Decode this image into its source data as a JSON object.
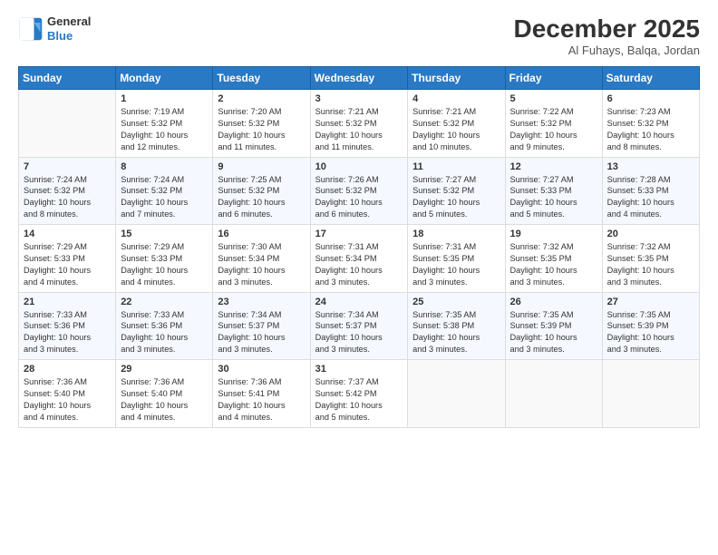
{
  "header": {
    "logo_line1": "General",
    "logo_line2": "Blue",
    "month_title": "December 2025",
    "location": "Al Fuhays, Balqa, Jordan"
  },
  "weekdays": [
    "Sunday",
    "Monday",
    "Tuesday",
    "Wednesday",
    "Thursday",
    "Friday",
    "Saturday"
  ],
  "weeks": [
    [
      {
        "day": "",
        "info": ""
      },
      {
        "day": "1",
        "info": "Sunrise: 7:19 AM\nSunset: 5:32 PM\nDaylight: 10 hours\nand 12 minutes."
      },
      {
        "day": "2",
        "info": "Sunrise: 7:20 AM\nSunset: 5:32 PM\nDaylight: 10 hours\nand 11 minutes."
      },
      {
        "day": "3",
        "info": "Sunrise: 7:21 AM\nSunset: 5:32 PM\nDaylight: 10 hours\nand 11 minutes."
      },
      {
        "day": "4",
        "info": "Sunrise: 7:21 AM\nSunset: 5:32 PM\nDaylight: 10 hours\nand 10 minutes."
      },
      {
        "day": "5",
        "info": "Sunrise: 7:22 AM\nSunset: 5:32 PM\nDaylight: 10 hours\nand 9 minutes."
      },
      {
        "day": "6",
        "info": "Sunrise: 7:23 AM\nSunset: 5:32 PM\nDaylight: 10 hours\nand 8 minutes."
      }
    ],
    [
      {
        "day": "7",
        "info": "Sunrise: 7:24 AM\nSunset: 5:32 PM\nDaylight: 10 hours\nand 8 minutes."
      },
      {
        "day": "8",
        "info": "Sunrise: 7:24 AM\nSunset: 5:32 PM\nDaylight: 10 hours\nand 7 minutes."
      },
      {
        "day": "9",
        "info": "Sunrise: 7:25 AM\nSunset: 5:32 PM\nDaylight: 10 hours\nand 6 minutes."
      },
      {
        "day": "10",
        "info": "Sunrise: 7:26 AM\nSunset: 5:32 PM\nDaylight: 10 hours\nand 6 minutes."
      },
      {
        "day": "11",
        "info": "Sunrise: 7:27 AM\nSunset: 5:32 PM\nDaylight: 10 hours\nand 5 minutes."
      },
      {
        "day": "12",
        "info": "Sunrise: 7:27 AM\nSunset: 5:33 PM\nDaylight: 10 hours\nand 5 minutes."
      },
      {
        "day": "13",
        "info": "Sunrise: 7:28 AM\nSunset: 5:33 PM\nDaylight: 10 hours\nand 4 minutes."
      }
    ],
    [
      {
        "day": "14",
        "info": "Sunrise: 7:29 AM\nSunset: 5:33 PM\nDaylight: 10 hours\nand 4 minutes."
      },
      {
        "day": "15",
        "info": "Sunrise: 7:29 AM\nSunset: 5:33 PM\nDaylight: 10 hours\nand 4 minutes."
      },
      {
        "day": "16",
        "info": "Sunrise: 7:30 AM\nSunset: 5:34 PM\nDaylight: 10 hours\nand 3 minutes."
      },
      {
        "day": "17",
        "info": "Sunrise: 7:31 AM\nSunset: 5:34 PM\nDaylight: 10 hours\nand 3 minutes."
      },
      {
        "day": "18",
        "info": "Sunrise: 7:31 AM\nSunset: 5:35 PM\nDaylight: 10 hours\nand 3 minutes."
      },
      {
        "day": "19",
        "info": "Sunrise: 7:32 AM\nSunset: 5:35 PM\nDaylight: 10 hours\nand 3 minutes."
      },
      {
        "day": "20",
        "info": "Sunrise: 7:32 AM\nSunset: 5:35 PM\nDaylight: 10 hours\nand 3 minutes."
      }
    ],
    [
      {
        "day": "21",
        "info": "Sunrise: 7:33 AM\nSunset: 5:36 PM\nDaylight: 10 hours\nand 3 minutes."
      },
      {
        "day": "22",
        "info": "Sunrise: 7:33 AM\nSunset: 5:36 PM\nDaylight: 10 hours\nand 3 minutes."
      },
      {
        "day": "23",
        "info": "Sunrise: 7:34 AM\nSunset: 5:37 PM\nDaylight: 10 hours\nand 3 minutes."
      },
      {
        "day": "24",
        "info": "Sunrise: 7:34 AM\nSunset: 5:37 PM\nDaylight: 10 hours\nand 3 minutes."
      },
      {
        "day": "25",
        "info": "Sunrise: 7:35 AM\nSunset: 5:38 PM\nDaylight: 10 hours\nand 3 minutes."
      },
      {
        "day": "26",
        "info": "Sunrise: 7:35 AM\nSunset: 5:39 PM\nDaylight: 10 hours\nand 3 minutes."
      },
      {
        "day": "27",
        "info": "Sunrise: 7:35 AM\nSunset: 5:39 PM\nDaylight: 10 hours\nand 3 minutes."
      }
    ],
    [
      {
        "day": "28",
        "info": "Sunrise: 7:36 AM\nSunset: 5:40 PM\nDaylight: 10 hours\nand 4 minutes."
      },
      {
        "day": "29",
        "info": "Sunrise: 7:36 AM\nSunset: 5:40 PM\nDaylight: 10 hours\nand 4 minutes."
      },
      {
        "day": "30",
        "info": "Sunrise: 7:36 AM\nSunset: 5:41 PM\nDaylight: 10 hours\nand 4 minutes."
      },
      {
        "day": "31",
        "info": "Sunrise: 7:37 AM\nSunset: 5:42 PM\nDaylight: 10 hours\nand 5 minutes."
      },
      {
        "day": "",
        "info": ""
      },
      {
        "day": "",
        "info": ""
      },
      {
        "day": "",
        "info": ""
      }
    ]
  ]
}
